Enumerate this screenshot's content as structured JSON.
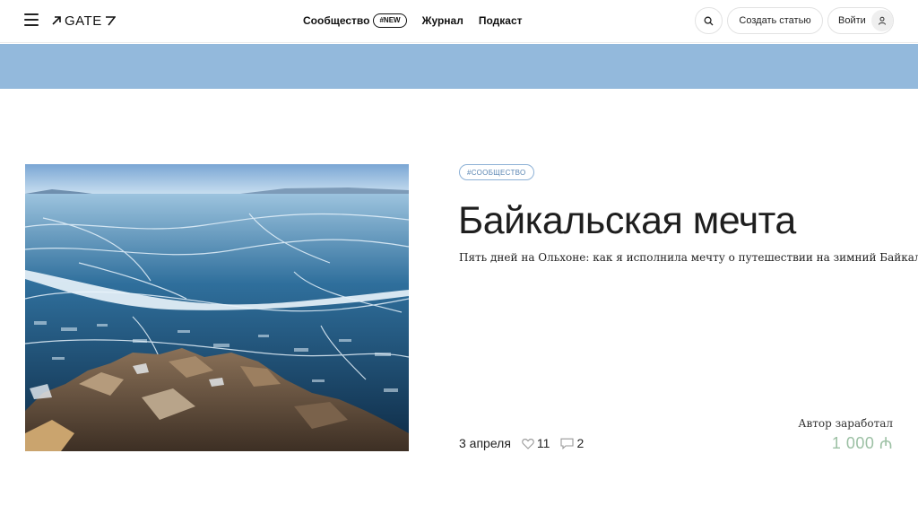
{
  "header": {
    "logo_text": "GATE",
    "nav": [
      {
        "label": "Сообщество",
        "badge": "#NEW"
      },
      {
        "label": "Журнал"
      },
      {
        "label": "Подкаст"
      }
    ],
    "create_label": "Создать статью",
    "login_label": "Войти"
  },
  "colors": {
    "banner": "#93b9dc",
    "tag": "#5b86b3",
    "earnings": "#9cc0a4"
  },
  "article": {
    "tag": "#СООБЩЕСТВО",
    "title": "Байкальская мечта",
    "subtitle": "Пять дней на Ольхоне: как я исполнила мечту о путешествии на зимний Байкал",
    "date": "3 апреля",
    "likes": "11",
    "comments": "2",
    "earned_label": "Автор заработал",
    "earned_value": "1 000 ₼"
  },
  "icons": [
    "menu-icon",
    "logo-arrow-icon",
    "search-icon",
    "user-icon",
    "heart-icon",
    "comment-icon"
  ]
}
